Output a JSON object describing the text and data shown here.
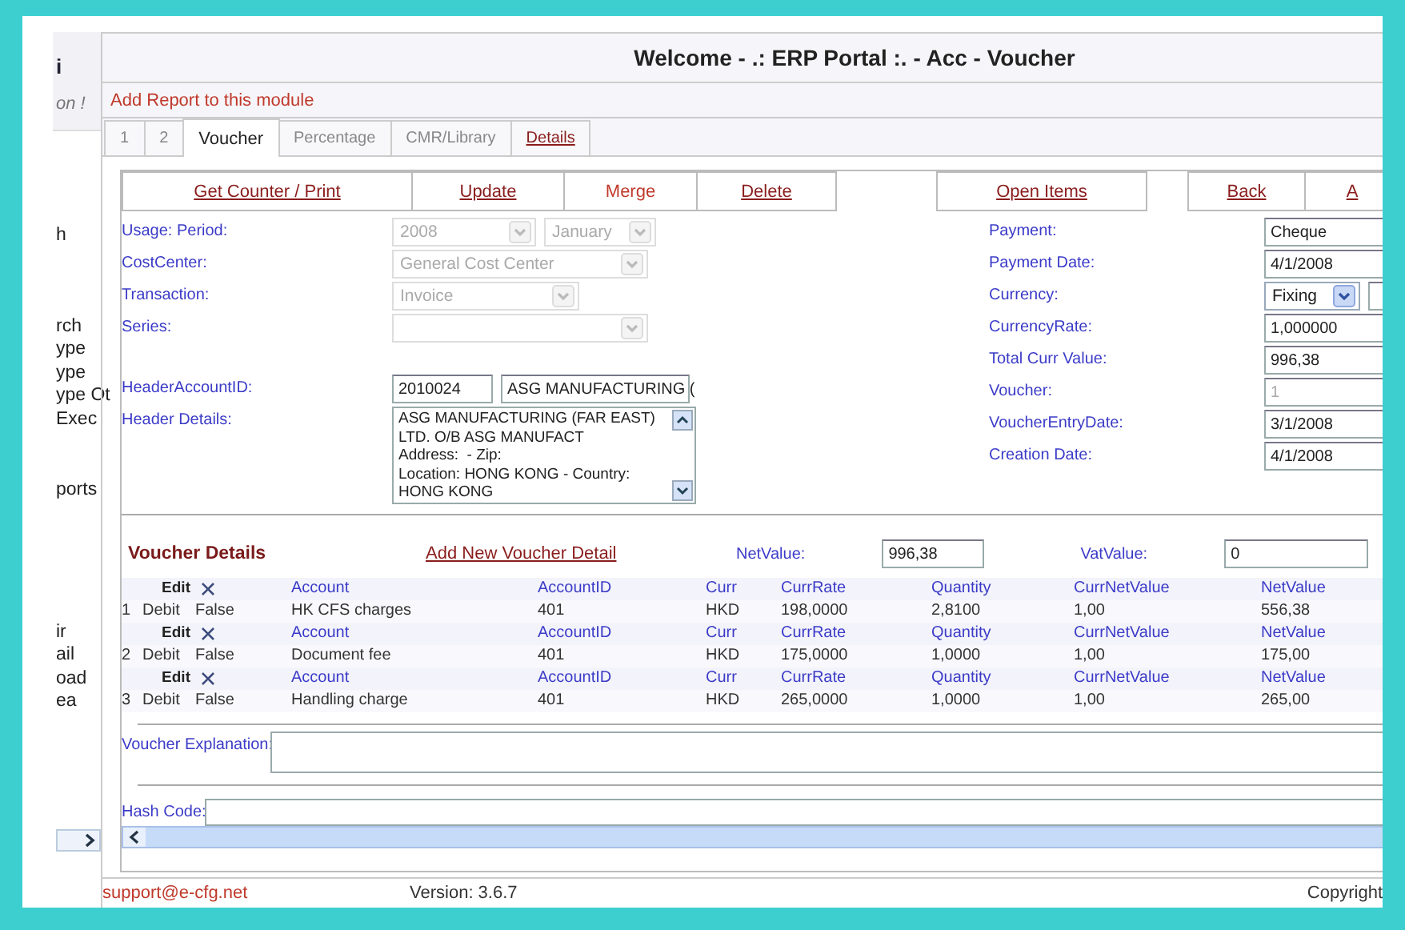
{
  "sidebar": {
    "title": "i",
    "subtitle": "on !",
    "groups": [
      [
        "h"
      ],
      [
        "rch",
        "ype",
        "ype",
        "ype Ot",
        "Exec"
      ],
      [
        "ports"
      ],
      [
        "ir",
        "ail",
        "oad",
        "ea"
      ]
    ]
  },
  "header": {
    "title": "Welcome - .: ERP Portal :. - Acc - Voucher"
  },
  "report_link": "Add Report to this module",
  "tabs": [
    {
      "label": "1",
      "selected": false,
      "kind": "plain"
    },
    {
      "label": "2",
      "selected": false,
      "kind": "plain"
    },
    {
      "label": "Voucher",
      "selected": true,
      "kind": "plain"
    },
    {
      "label": "Percentage",
      "selected": false,
      "kind": "plain"
    },
    {
      "label": "CMR/Library",
      "selected": false,
      "kind": "plain"
    },
    {
      "label": "Details",
      "selected": false,
      "kind": "link"
    }
  ],
  "action_groups": [
    [
      {
        "label": "Get Counter / Print",
        "kind": "link"
      },
      {
        "label": "Update",
        "kind": "link"
      },
      {
        "label": "Merge",
        "kind": "plain"
      },
      {
        "label": "Delete",
        "kind": "link"
      }
    ],
    [
      {
        "label": "Open Items",
        "kind": "link"
      }
    ],
    [
      {
        "label": "Back",
        "kind": "link"
      },
      {
        "label": "A",
        "kind": "link"
      }
    ]
  ],
  "left_fields": [
    {
      "label": "Usage: Period:",
      "controls": [
        {
          "kind": "select",
          "value": "2008",
          "disabled": true
        },
        {
          "kind": "select",
          "value": "January",
          "disabled": true
        }
      ]
    },
    {
      "label": "CostCenter:",
      "controls": [
        {
          "kind": "select",
          "value": "General Cost Center",
          "disabled": true
        }
      ]
    },
    {
      "label": "Transaction:",
      "controls": [
        {
          "kind": "select",
          "value": "Invoice",
          "disabled": true
        }
      ]
    },
    {
      "label": "Series:",
      "controls": [
        {
          "kind": "select",
          "disabled": true
        }
      ]
    },
    {
      "label": "HeaderAccountID:",
      "controls": [
        {
          "kind": "input",
          "value": "2010024",
          "disabled": false
        },
        {
          "kind": "input",
          "value": "ASG MANUFACTURING (",
          "disabled": false
        }
      ]
    },
    {
      "label": "Header Details:",
      "controls": [
        {
          "kind": "textarea",
          "lines": [
            "ASG MANUFACTURING (FAR EAST)",
            "LTD. O/B ASG MANUFACT",
            "Address:  - Zip:",
            "Location: HONG KONG - Country:",
            "HONG KONG"
          ],
          "disabled": false
        }
      ]
    }
  ],
  "right_fields": [
    {
      "label": "Payment:",
      "kind": "input",
      "value": "Cheque",
      "disabled": false
    },
    {
      "label": "Payment Date:",
      "kind": "input",
      "value": "4/1/2008",
      "disabled": false
    },
    {
      "label": "Currency:",
      "kind": "select",
      "value": "Fixing",
      "disabled": false
    },
    {
      "label": "CurrencyRate:",
      "kind": "input",
      "value": "1,000000",
      "disabled": false
    },
    {
      "label": "Total Curr Value:",
      "kind": "input",
      "value": "996,38",
      "disabled": false
    },
    {
      "label": "Voucher:",
      "kind": "input",
      "value": "1",
      "disabled": true
    },
    {
      "label": "VoucherEntryDate:",
      "kind": "input",
      "value": "3/1/2008",
      "disabled": false
    },
    {
      "label": "Creation Date:",
      "kind": "input",
      "value": "4/1/2008",
      "disabled": false
    }
  ],
  "voucher_details": {
    "title": "Voucher Details",
    "add_link": "Add New Voucher Detail",
    "net_label": "NetValue:",
    "net_value": "996,38",
    "vat_label": "VatValue:",
    "vat_value": "0"
  },
  "voucher_rows": [
    {
      "header": [
        "Edit",
        "Account",
        "AccountID",
        "Curr",
        "CurrRate",
        "Quantity",
        "CurrNetValue",
        "NetValue"
      ],
      "values": [
        "1",
        "Debit",
        "False",
        "HK CFS charges",
        "401",
        "HKD",
        "198,0000",
        "2,8100",
        "1,00",
        "556,38"
      ]
    },
    {
      "header": [
        "Edit",
        "Account",
        "AccountID",
        "Curr",
        "CurrRate",
        "Quantity",
        "CurrNetValue",
        "NetValue"
      ],
      "values": [
        "2",
        "Debit",
        "False",
        "Document fee",
        "401",
        "HKD",
        "175,0000",
        "1,0000",
        "1,00",
        "175,00"
      ]
    },
    {
      "header": [
        "Edit",
        "Account",
        "AccountID",
        "Curr",
        "CurrRate",
        "Quantity",
        "CurrNetValue",
        "NetValue"
      ],
      "values": [
        "3",
        "Debit",
        "False",
        "Handling charge",
        "401",
        "HKD",
        "265,0000",
        "1,0000",
        "1,00",
        "265,00"
      ]
    }
  ],
  "explanation_label": "Voucher Explanation:",
  "hash_label": "Hash Code:",
  "footer": {
    "email": "support@e-cfg.net",
    "version": "Version: 3.6.7",
    "copyright": "Copyright"
  }
}
